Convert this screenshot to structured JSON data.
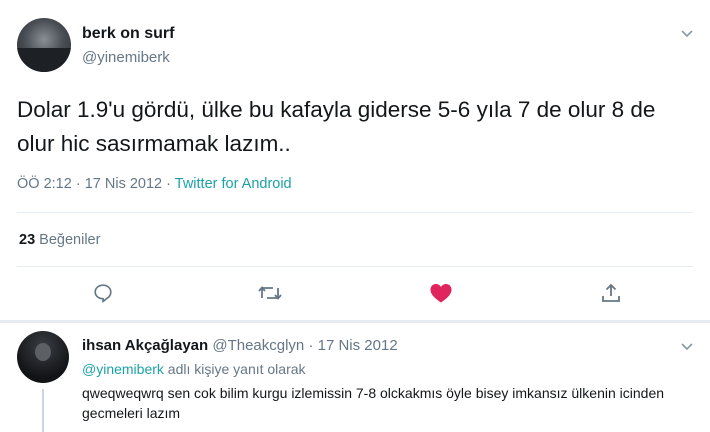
{
  "tweet": {
    "author_name": "berk on surf",
    "author_handle": "@yinemiberk",
    "text": "Dolar 1.9'u gördü, ülke bu kafayla giderse 5-6 yıla 7 de olur 8 de olur hic sasırmamak lazım..",
    "time": "ÖÖ 2:12",
    "dot": "·",
    "date": "17 Nis 2012",
    "source": "Twitter for Android",
    "like_count": "23",
    "likes_label": "Beğeniler"
  },
  "actions": [
    {
      "icon": "reply-icon"
    },
    {
      "icon": "retweet-icon"
    },
    {
      "icon": "heart-icon",
      "color": "#e0245e"
    },
    {
      "icon": "share-icon"
    }
  ],
  "reply": {
    "author_name": "ihsan Akçağlayan",
    "author_handle": "@Theakcglyn",
    "dot": "·",
    "date": "17 Nis 2012",
    "replying_to_mention": "@yinemiberk",
    "replying_to_suffix": "adlı kişiye yanıt olarak",
    "text": "qweqweqwrq sen cok bilim kurgu izlemissin 7-8 olckakmıs öyle bisey imkansız ülkenin icinden gecmeleri lazım"
  },
  "colors": {
    "accent": "#1da1a8",
    "like": "#e0245e",
    "muted": "#657786"
  }
}
